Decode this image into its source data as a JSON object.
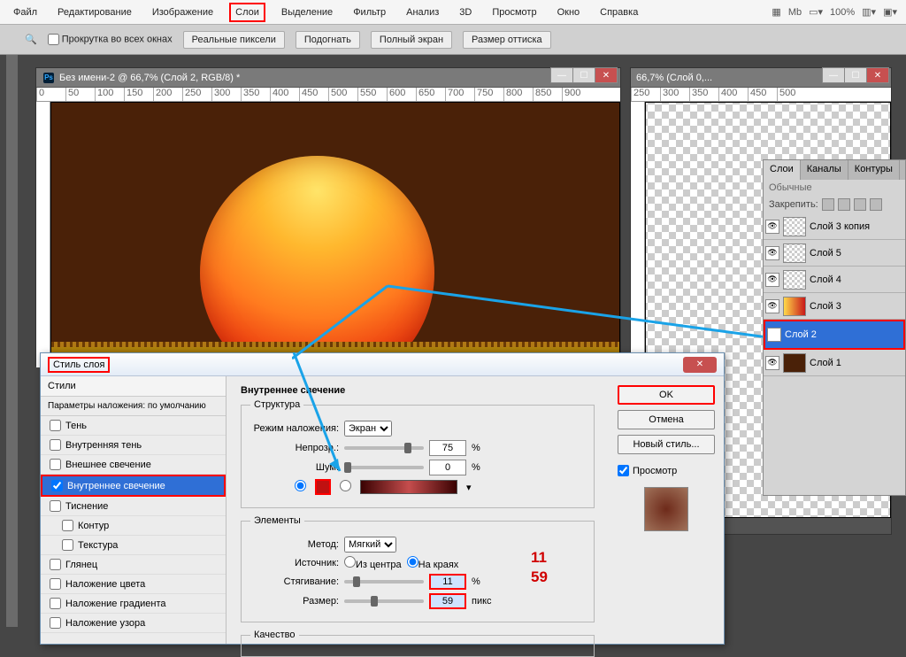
{
  "menu": {
    "file": "Файл",
    "edit": "Редактирование",
    "image": "Изображение",
    "layers": "Слои",
    "select": "Выделение",
    "filter": "Фильтр",
    "analysis": "Анализ",
    "threeD": "3D",
    "view": "Просмотр",
    "window": "Окно",
    "help": "Справка",
    "zoom": "100%"
  },
  "optbar": {
    "scroll": "Прокрутка во всех окнах",
    "actual": "Реальные пиксели",
    "fit": "Подогнать",
    "full": "Полный экран",
    "print": "Размер оттиска"
  },
  "doc1": {
    "title": "Без имени-2 @ 66,7% (Слой 2, RGB/8) *"
  },
  "doc2": {
    "title": "66,7% (Слой 0,..."
  },
  "layers": {
    "tab1": "Слои",
    "tab2": "Каналы",
    "tab3": "Контуры",
    "mode": "Обычные",
    "lock": "Закрепить:",
    "items": [
      "Слой 3 копия",
      "Слой 5",
      "Слой 4",
      "Слой 3",
      "Слой 2",
      "Слой 1"
    ]
  },
  "dlg": {
    "title": "Стиль слоя",
    "left": {
      "styles": "Стили",
      "defaults": "Параметры наложения: по умолчанию",
      "opts": [
        "Тень",
        "Внутренняя тень",
        "Внешнее свечение",
        "Внутреннее свечение",
        "Тиснение",
        "Контур",
        "Текстура",
        "Глянец",
        "Наложение цвета",
        "Наложение градиента",
        "Наложение узора"
      ]
    },
    "mid": {
      "title": "Внутреннее свечение",
      "struct": "Структура",
      "blend": "Режим наложения:",
      "blendVal": "Экран",
      "opacity": "Непрозр.:",
      "opacityVal": "75",
      "noise": "Шум:",
      "noiseVal": "0",
      "pct": "%",
      "elements": "Элементы",
      "method": "Метод:",
      "methodVal": "Мягкий",
      "source": "Источник:",
      "center": "Из центра",
      "edge": "На краях",
      "choke": "Стягивание:",
      "chokeVal": "11",
      "size": "Размер:",
      "sizeVal": "59",
      "px": "пикс",
      "quality": "Качество"
    },
    "right": {
      "ok": "OK",
      "cancel": "Отмена",
      "newstyle": "Новый стиль...",
      "preview": "Просмотр"
    }
  },
  "annot": {
    "v1": "11",
    "v2": "59"
  }
}
